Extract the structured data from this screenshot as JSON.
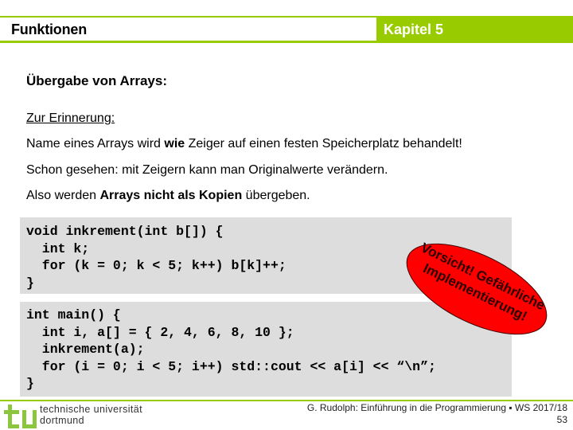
{
  "header": {
    "title": "Funktionen",
    "chapter": "Kapitel 5",
    "accent_color": "#99cc00"
  },
  "content": {
    "heading": "Übergabe von Arrays:",
    "reminder_label": "Zur Erinnerung:",
    "line1": {
      "pre": "Name eines Arrays wird ",
      "bold": "wie",
      "post": " Zeiger auf einen festen Speicherplatz behandelt!"
    },
    "line2": "Schon gesehen: mit Zeigern kann man Originalwerte verändern.",
    "line3": {
      "pre": "Also werden ",
      "bold": "Arrays nicht als Kopien",
      "post": " übergeben."
    }
  },
  "code_blocks": [
    {
      "lines": [
        "void inkrement(int b[]) {",
        "  int k;",
        "  for (k = 0; k < 5; k++) b[k]++;",
        "}"
      ]
    },
    {
      "lines": [
        "int main() {",
        "  int i, a[] = { 2, 4, 6, 8, 10 };",
        "  inkrement(a);",
        "  for (i = 0; i < 5; i++) std::cout << a[i] << “\\n”;",
        "}"
      ]
    }
  ],
  "warning_stamp": {
    "line1": "Vorsicht! Gefährliche",
    "line2": "Implementierung!",
    "color": "#ff0000"
  },
  "footer": {
    "university_line1": "technische universität",
    "university_line2": "dortmund",
    "credit": "G. Rudolph: Einführung in die Programmierung ▪ WS 2017/18",
    "page_number": "53"
  }
}
